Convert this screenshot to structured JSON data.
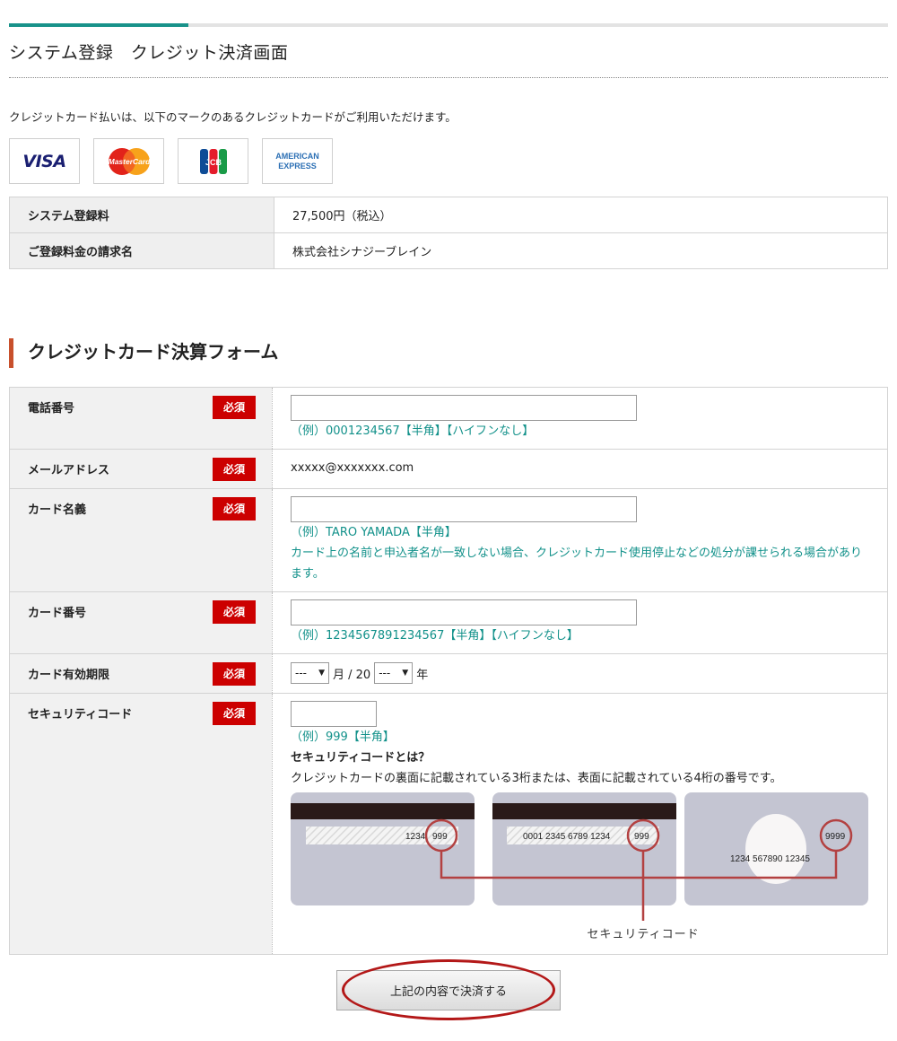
{
  "page_title": "システム登録　クレジット決済画面",
  "intro": "クレジットカード払いは、以下のマークのあるクレジットカードがご利用いただけます。",
  "card_brands": {
    "visa": "VISA",
    "mastercard": "MasterCard",
    "jcb": "JCB",
    "amex_line1": "AMERICAN",
    "amex_line2": "EXPRESS"
  },
  "info": {
    "fee_label": "システム登録料",
    "fee_value": "27,500円（税込）",
    "billing_label": "ご登録料金の請求名",
    "billing_value": "株式会社シナジーブレイン"
  },
  "form": {
    "section_title": "クレジットカード決算フォーム",
    "required_badge": "必須",
    "phone": {
      "label": "電話番号",
      "value": "",
      "hint": "（例）0001234567【半角】【ハイフンなし】"
    },
    "email": {
      "label": "メールアドレス",
      "value": "xxxxx@xxxxxxx.com"
    },
    "card_name": {
      "label": "カード名義",
      "value": "",
      "hint": "（例）TARO YAMADA【半角】",
      "note": "カード上の名前と申込者名が一致しない場合、クレジットカード使用停止などの処分が課せられる場合があります。"
    },
    "card_number": {
      "label": "カード番号",
      "value": "",
      "hint": "（例）1234567891234567【半角】【ハイフンなし】"
    },
    "expiry": {
      "label": "カード有効期限",
      "month_value": "---",
      "month_unit": "月 / 20",
      "year_value": "---",
      "year_unit": "年"
    },
    "security": {
      "label": "セキュリティコード",
      "value": "",
      "hint": "（例）999【半角】",
      "heading": "セキュリティコードとは？",
      "description": "クレジットカードの裏面に記載されている3桁または、表面に記載されている4桁の番号です。",
      "illustration": {
        "card1_digits": "1234",
        "card1_code": "999",
        "card2_digits": "0001  2345  6789  1234",
        "card2_code": "999",
        "card3_code": "9999",
        "card3_digits": "1234  567890  12345",
        "caption": "セキュリティコード"
      }
    }
  },
  "submit_label": "上記の内容で決済する",
  "colors": {
    "accent_teal": "#18928a",
    "hint_teal": "#12918a",
    "required_red": "#cc0000",
    "section_bar": "#c8502c",
    "highlight_red": "#b31818"
  }
}
